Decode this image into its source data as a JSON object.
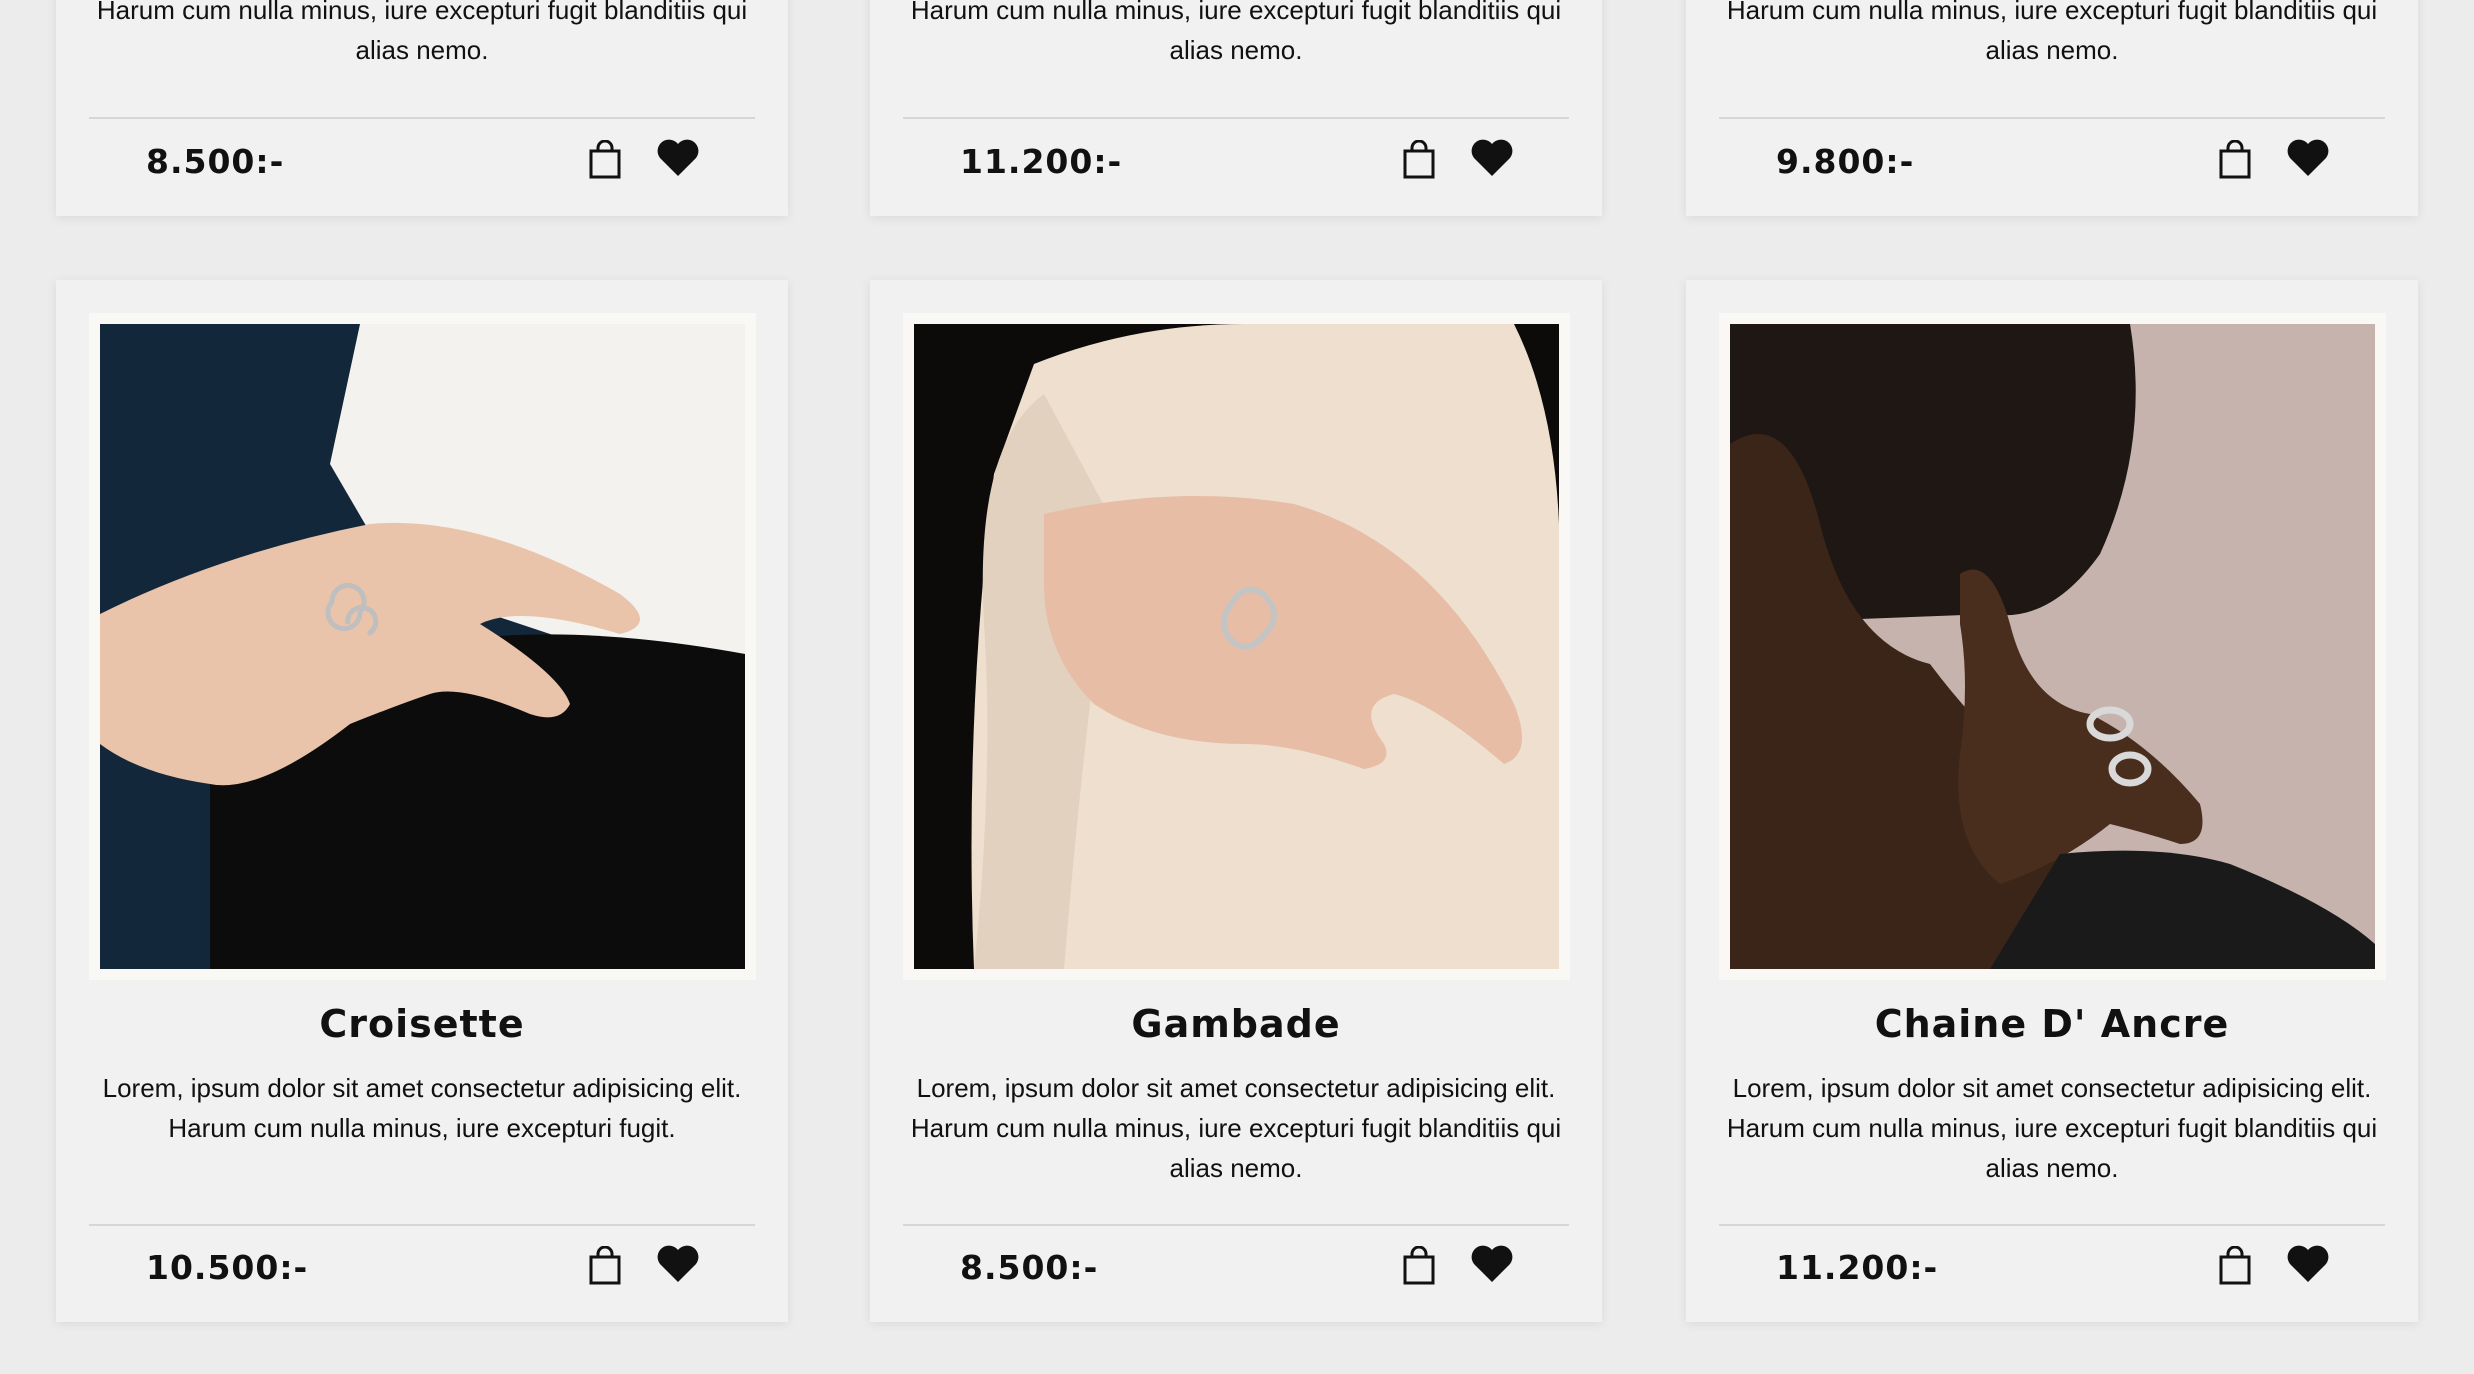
{
  "products_top": [
    {
      "description": "Harum cum nulla minus, iure excepturi fugit blanditiis qui alias nemo.",
      "price": "8.500:-"
    },
    {
      "description": "Harum cum nulla minus, iure excepturi fugit blanditiis qui alias nemo.",
      "price": "11.200:-"
    },
    {
      "description": "Harum cum nulla minus, iure excepturi fugit blanditiis qui alias nemo.",
      "price": "9.800:-"
    }
  ],
  "products": [
    {
      "name": "Croisette",
      "description": "Lorem, ipsum dolor sit amet consectetur adipisicing elit. Harum cum nulla minus, iure excepturi fugit.",
      "price": "10.500:-"
    },
    {
      "name": "Gambade",
      "description": "Lorem, ipsum dolor sit amet consectetur adipisicing elit. Harum cum nulla minus, iure excepturi fugit blanditiis qui alias nemo.",
      "price": "8.500:-"
    },
    {
      "name": "Chaine D' Ancre",
      "description": "Lorem, ipsum dolor sit amet consectetur adipisicing elit. Harum cum nulla minus, iure excepturi fugit blanditiis qui alias nemo.",
      "price": "11.200:-"
    }
  ],
  "icons": {
    "cart": "shopping-bag-icon",
    "favorite": "heart-icon"
  },
  "colors": {
    "background": "#ececec",
    "card": "#f1f1f1",
    "text": "#111111"
  }
}
